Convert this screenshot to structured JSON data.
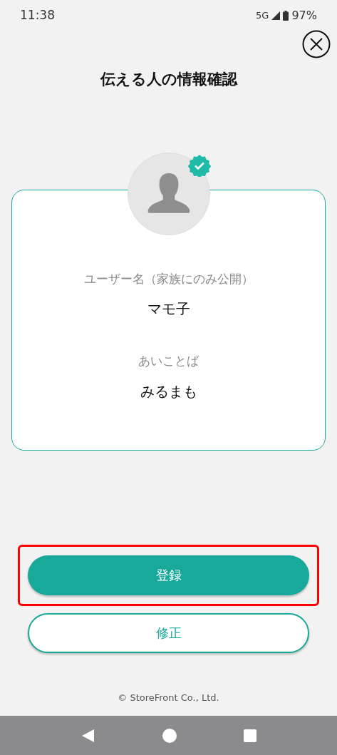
{
  "status_bar": {
    "time": "11:38",
    "network": "5G",
    "battery": "97%"
  },
  "title": "伝える人の情報確認",
  "avatar": {
    "verified": true
  },
  "fields": [
    {
      "label": "ユーザー名（家族にのみ公開）",
      "value": "マモ子"
    },
    {
      "label": "あいことば",
      "value": "みるまも"
    }
  ],
  "buttons": [
    {
      "label": "登録",
      "kind": "primary",
      "highlighted": true
    },
    {
      "label": "修正",
      "kind": "secondary",
      "highlighted": false
    }
  ],
  "footer": "© StoreFront Co., Ltd."
}
